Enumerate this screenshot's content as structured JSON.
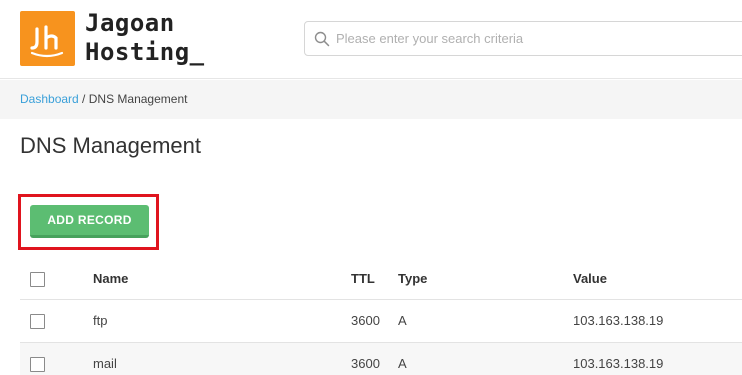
{
  "brand": {
    "line1": "Jagoan",
    "line2": "Hosting_",
    "logo_icon": "jh-logo-icon",
    "logo_color": "#f7931e"
  },
  "search": {
    "placeholder": "Please enter your search criteria",
    "value": "",
    "icon": "search-icon"
  },
  "breadcrumb": {
    "home": "Dashboard",
    "separator": " / ",
    "current": "DNS Management"
  },
  "page": {
    "title": "DNS Management"
  },
  "actions": {
    "add_record": "ADD RECORD",
    "accent": "#5cbd72",
    "highlight_color": "#e0141e"
  },
  "table": {
    "columns": {
      "name": "Name",
      "ttl": "TTL",
      "type": "Type",
      "value": "Value"
    },
    "rows": [
      {
        "name": "ftp",
        "ttl": "3600",
        "type": "A",
        "value": "103.163.138.19",
        "checked": false
      },
      {
        "name": "mail",
        "ttl": "3600",
        "type": "A",
        "value": "103.163.138.19",
        "checked": false
      }
    ]
  }
}
